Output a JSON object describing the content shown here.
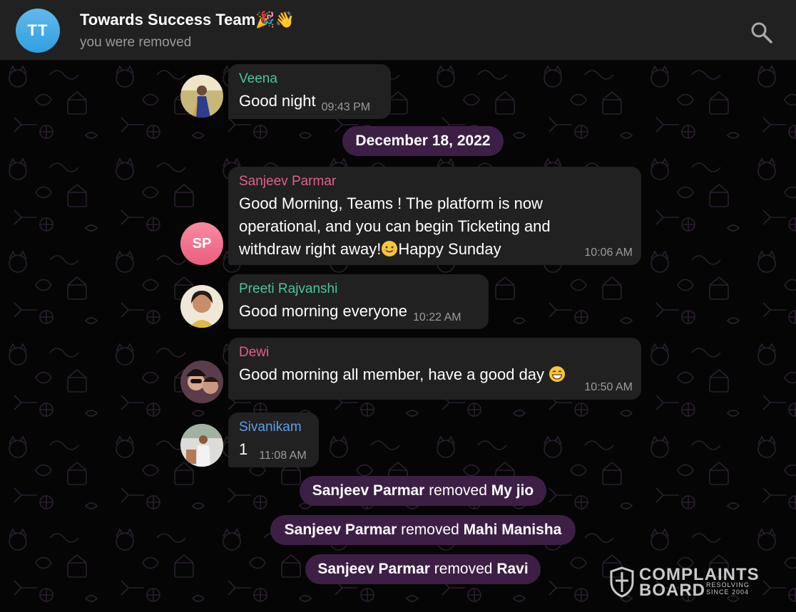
{
  "header": {
    "avatar_initials": "TT",
    "title": "Towards Success Team🎉👋",
    "subtitle": "you were removed",
    "search_icon": "search-icon"
  },
  "messages": [
    {
      "sender": "Veena",
      "sender_color": "#4cc59a",
      "text": "Good night",
      "time": "09:43 PM",
      "avatar": "photo"
    },
    {
      "sender": "Sanjeev Parmar",
      "sender_color": "#e45f8b",
      "text": "Good Morning, Teams ! The platform is now operational, and you can begin Ticketing and withdraw right away!",
      "text_tail": "Happy Sunday",
      "time": "10:06 AM",
      "avatar_initials": "SP"
    },
    {
      "sender": "Preeti Rajvanshi",
      "sender_color": "#4cc59a",
      "text": "Good morning everyone",
      "time": "10:22 AM",
      "avatar": "photo"
    },
    {
      "sender": "Dewi",
      "sender_color": "#e45f8b",
      "text": "Good morning all member, have a good day",
      "time": "10:50 AM",
      "avatar": "photo"
    },
    {
      "sender": "Sivanikam",
      "sender_color": "#5a9ff0",
      "text": "1",
      "time": "11:08 AM",
      "avatar": "photo"
    }
  ],
  "date_separator": "December 18, 2022",
  "service_messages": [
    {
      "actor": "Sanjeev Parmar",
      "action": "removed",
      "target": "My jio"
    },
    {
      "actor": "Sanjeev Parmar",
      "action": "removed",
      "target": "Mahi Manisha"
    },
    {
      "actor": "Sanjeev Parmar",
      "action": "removed",
      "target": "Ravi"
    }
  ],
  "watermark": {
    "line1": "COMPLAINTS",
    "line2": "BOARD",
    "small1": "RESOLVING",
    "small2": "SINCE 2004"
  },
  "colors": {
    "header_bg": "#212121",
    "bubble_bg": "#212121",
    "pill_bg": "#3d1f45",
    "chat_bg": "#050505"
  }
}
